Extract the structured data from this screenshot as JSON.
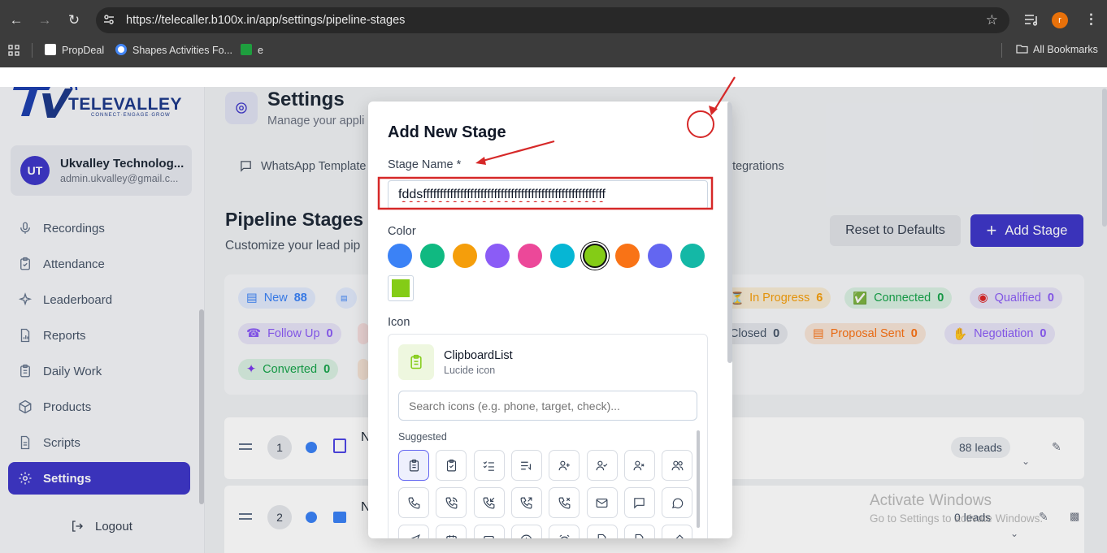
{
  "browser": {
    "url": "https://telecaller.b100x.in/app/settings/pipeline-stages",
    "profile_initial": "r",
    "bookmarks": [
      {
        "label": "PropDeal",
        "color": "#ffffff"
      },
      {
        "label": "Shapes Activities Fo...",
        "color": "#4285f4"
      },
      {
        "label": "e",
        "color": "#1e9e3e"
      }
    ],
    "all_bookmarks": "All Bookmarks"
  },
  "sidebar": {
    "brand": "TELEVALLEY",
    "tagline": "CONNECT·ENGAGE·GROW",
    "user": {
      "initials": "UT",
      "name": "Ukvalley Technolog...",
      "email": "admin.ukvalley@gmail.c..."
    },
    "items": [
      {
        "label": "Recordings",
        "icon": "mic-icon"
      },
      {
        "label": "Attendance",
        "icon": "clipboard-check-icon"
      },
      {
        "label": "Leaderboard",
        "icon": "sparkle-icon"
      },
      {
        "label": "Reports",
        "icon": "file-chart-icon"
      },
      {
        "label": "Daily Work",
        "icon": "clipboard-list-icon"
      },
      {
        "label": "Products",
        "icon": "box-icon"
      },
      {
        "label": "Scripts",
        "icon": "file-text-icon"
      },
      {
        "label": "Settings",
        "icon": "gear-icon"
      }
    ],
    "logout": "Logout"
  },
  "main": {
    "title": "Settings",
    "subtitle": "Manage your appli",
    "tabs": [
      "WhatsApp Template",
      "ntegrations"
    ],
    "section_title": "Pipeline Stages",
    "section_subtitle": "Customize your lead pip",
    "reset_button": "Reset to Defaults",
    "add_button": "Add Stage",
    "stage_badges": [
      {
        "label": "New",
        "count": "88",
        "color": "#3b82f6",
        "bg": "#e0e9fb"
      },
      {
        "label": "In Progress",
        "count": "6",
        "color": "#f59e0b",
        "bg": "#f6ead3"
      },
      {
        "label": "Connected",
        "count": "0",
        "color": "#16a34a",
        "bg": "#d9efe1"
      },
      {
        "label": "Qualified",
        "count": "0",
        "color": "#8b5cf6",
        "bg": "#e6e2f6"
      },
      {
        "label": "Follow Up",
        "count": "0",
        "color": "#8b5cf6",
        "bg": "#e6e2f6"
      },
      {
        "label": "Closed",
        "count": "0",
        "color": "#64748b",
        "bg": "#e2e5ea"
      },
      {
        "label": "Proposal Sent",
        "count": "0",
        "color": "#f97316",
        "bg": "#f6e3d6"
      },
      {
        "label": "Negotiation",
        "count": "0",
        "color": "#8b5cf6",
        "bg": "#e6e2f6"
      },
      {
        "label": "Converted",
        "count": "0",
        "color": "#16a34a",
        "bg": "#d9efe1"
      }
    ],
    "rows": [
      {
        "index": "1",
        "initial": "N",
        "leads": "88 leads"
      },
      {
        "index": "2",
        "initial": "N",
        "leads": "0 leads"
      }
    ]
  },
  "modal": {
    "title": "Add New Stage",
    "name_label": "Stage Name *",
    "name_value": "fddsffffffffffffffffffffffffffffffffffffffffffffffffffffff",
    "color_label": "Color",
    "colors": [
      "#3b82f6",
      "#10b981",
      "#f59e0b",
      "#8b5cf6",
      "#ec4899",
      "#06b6d4",
      "#84cc16",
      "#f97316",
      "#6366f1",
      "#14b8a6"
    ],
    "selected_color_index": 6,
    "custom_color": "#84cc16",
    "icon_label": "Icon",
    "selected_icon_name": "ClipboardList",
    "selected_icon_sub": "Lucide icon",
    "search_placeholder": "Search icons (e.g. phone, target, check)...",
    "suggested_label": "Suggested",
    "icons": [
      "clipboard-list-icon",
      "clipboard-check-icon",
      "list-checks-icon",
      "list-end-icon",
      "user-plus-icon",
      "user-check-icon",
      "user-x-icon",
      "users-icon",
      "phone-icon",
      "phone-call-icon",
      "phone-incoming-icon",
      "phone-outgoing-icon",
      "phone-missed-icon",
      "mail-icon",
      "message-square-icon",
      "message-circle-icon",
      "send-icon",
      "calendar-icon",
      "calendar-check-icon",
      "clock-icon",
      "alarm-clock-icon",
      "file-check-icon",
      "file-icon",
      "pen-icon"
    ]
  },
  "watermark": {
    "title": "Activate Windows",
    "subtitle": "Go to Settings to activate Windows."
  },
  "accent": "#3f37c9",
  "annotation_color": "#d62828"
}
